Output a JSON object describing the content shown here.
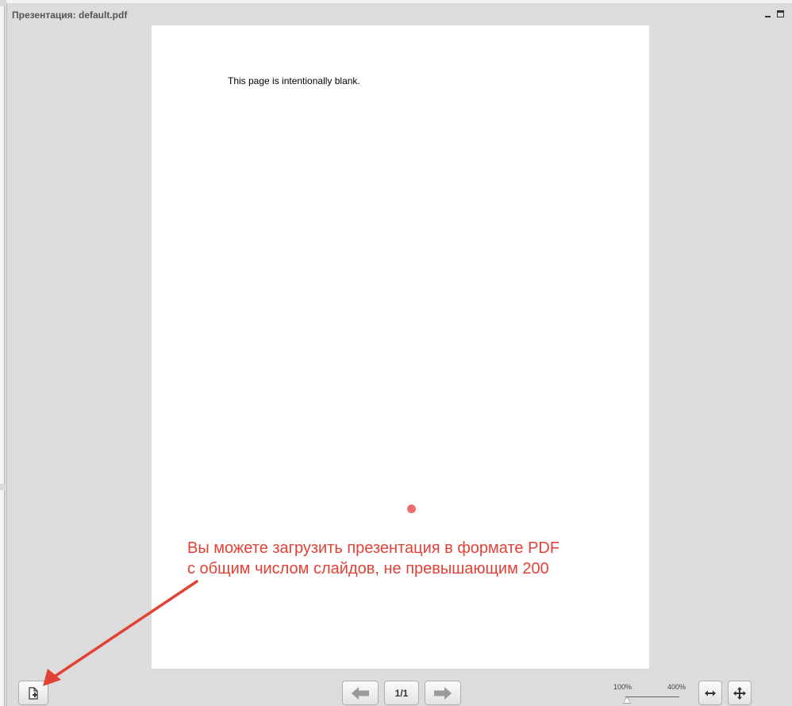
{
  "panel": {
    "title": "Презентация: default.pdf"
  },
  "slide": {
    "text": "This page is intentionally blank."
  },
  "annotation": {
    "line1": "Вы можете загрузить презентация в формате PDF",
    "line2": "с общим числом слайдов, не превышающим 200",
    "color": "#e24135"
  },
  "toolbar": {
    "page_indicator": "1/1",
    "zoom_min_label": "100%",
    "zoom_max_label": "400%",
    "zoom_level": 0
  },
  "icons": {
    "upload": "upload-presentation-icon",
    "prev": "arrow-left-icon",
    "next": "arrow-right-icon",
    "fit_width": "fit-width-icon",
    "fit_page": "move-icon"
  }
}
